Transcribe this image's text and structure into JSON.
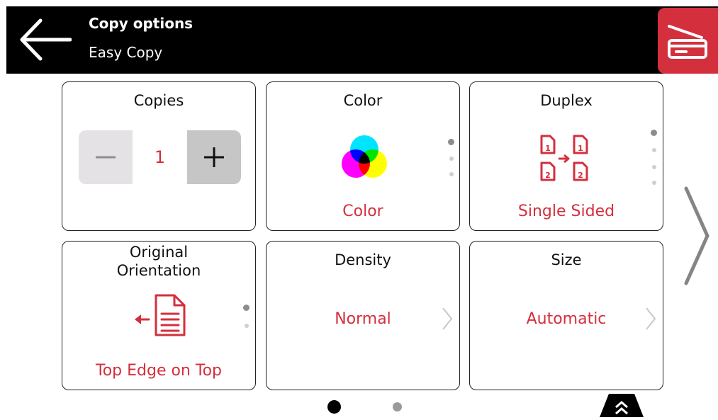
{
  "header": {
    "title": "Copy options",
    "subtitle": "Easy Copy",
    "back_icon": "arrow-left-icon",
    "scan_icon": "scanner-icon",
    "scan_color": "#d42f3c"
  },
  "tiles": {
    "copies": {
      "title": "Copies",
      "value": "1"
    },
    "color": {
      "title": "Color",
      "value": "Color",
      "icon": "color-cmy-icon"
    },
    "duplex": {
      "title": "Duplex",
      "value": "Single Sided",
      "icon": "duplex-icon"
    },
    "orientation": {
      "title_line1": "Original",
      "title_line2": "Orientation",
      "value": "Top Edge on Top",
      "icon": "orientation-icon"
    },
    "density": {
      "title": "Density",
      "value": "Normal"
    },
    "size": {
      "title": "Size",
      "value": "Automatic"
    }
  },
  "pagination": {
    "current_page": 1,
    "total_pages": 2
  },
  "colors": {
    "accent": "#d42f3c",
    "header_bg": "#000000"
  }
}
